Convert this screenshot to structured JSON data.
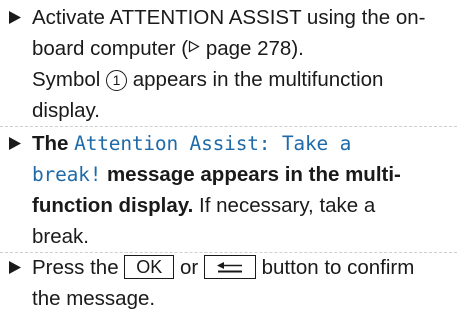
{
  "steps": [
    {
      "line1": "Activate ATTENTION ASSIST using the on-",
      "line2_a": "board computer (",
      "line2_ref_icon": "triangle-right-icon",
      "line2_b": "page 278).",
      "line3_a": "Symbol ",
      "symbol_number": "1",
      "line3_b": " appears in the multifunction",
      "line4": "display."
    },
    {
      "bold_lead": "The ",
      "message_line1": "Attention Assist: Take a",
      "message_line2": "break!",
      "bold_rest_line2": " message appears in the multi-",
      "bold_line3": "function display.",
      "normal_line3": " If necessary, take a",
      "line4": "break."
    },
    {
      "line1_a": "Press the ",
      "key_ok": "OK",
      "line1_or": " or ",
      "key_back_icon": "back-arrow-icon",
      "line1_b": " button to confirm",
      "line2": "the message."
    }
  ],
  "colors": {
    "text": "#1a1a1a",
    "message": "#1f6aa8",
    "separator": "#cfcfcf"
  }
}
